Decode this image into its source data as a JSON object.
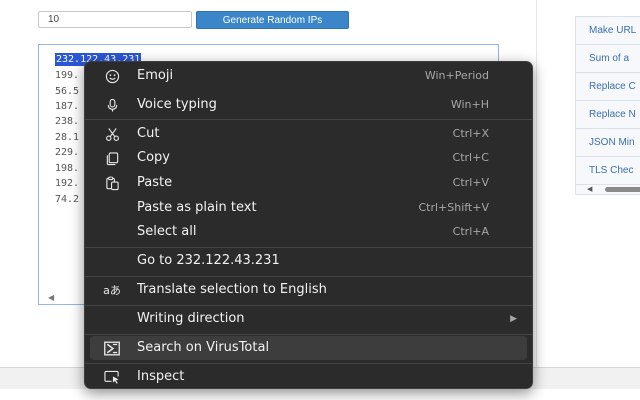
{
  "form": {
    "count_value": "10",
    "generate_label": "Generate Random IPs"
  },
  "output": {
    "lines": [
      "232.122.43.231",
      "199.",
      "56.5",
      "187.",
      "238.",
      "28.1",
      "229.",
      "198.",
      "192.",
      "74.2"
    ],
    "scroll_left": "◀"
  },
  "tools": {
    "items": [
      "Make URL",
      "Sum of a",
      "Replace C",
      "Replace N",
      "JSON Min",
      "TLS Chec"
    ],
    "scroll_left": "◀"
  },
  "context_menu": {
    "items": [
      {
        "icon": "emoji-icon",
        "label": "Emoji",
        "shortcut": "Win+Period"
      },
      {
        "icon": "microphone-icon",
        "label": "Voice typing",
        "shortcut": "Win+H"
      },
      {
        "icon": "scissors-icon",
        "label": "Cut",
        "shortcut": "Ctrl+X"
      },
      {
        "icon": "copy-icon",
        "label": "Copy",
        "shortcut": "Ctrl+C"
      },
      {
        "icon": "clipboard-icon",
        "label": "Paste",
        "shortcut": "Ctrl+V"
      },
      {
        "icon": "",
        "label": "Paste as plain text",
        "shortcut": "Ctrl+Shift+V"
      },
      {
        "icon": "",
        "label": "Select all",
        "shortcut": "Ctrl+A"
      },
      {
        "icon": "",
        "label": "Go to 232.122.43.231",
        "shortcut": ""
      },
      {
        "icon": "translate-icon",
        "label": "Translate selection to English",
        "shortcut": ""
      },
      {
        "icon": "",
        "label": "Writing direction",
        "shortcut": "",
        "submenu": "▶"
      },
      {
        "icon": "virustotal-icon",
        "label": "Search on VirusTotal",
        "shortcut": ""
      },
      {
        "icon": "inspect-icon",
        "label": "Inspect",
        "shortcut": ""
      }
    ],
    "highlighted_item": "Search on VirusTotal",
    "translate_glyph": "aあ"
  }
}
